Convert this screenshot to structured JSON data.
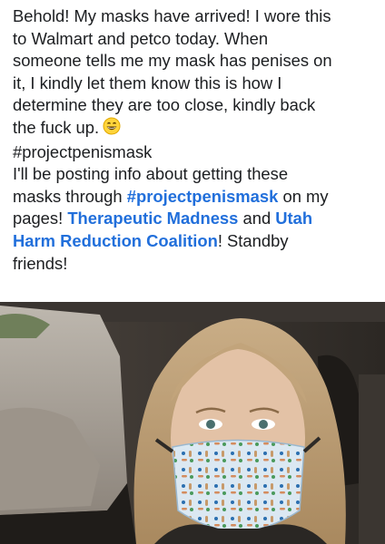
{
  "post": {
    "lines": [
      {
        "text": "Behold! My masks have arrived! I wore this"
      },
      {
        "text": "to Walmart and petco today. When"
      },
      {
        "text": "someone tells me my mask has penises on"
      },
      {
        "text": "it, I kindly let them know this is how I"
      },
      {
        "text": "determine they are too close, kindly back"
      },
      {
        "text": "the fuck up."
      },
      {
        "hashtag": "#projectpenismask"
      },
      {
        "text": "I'll be posting info about getting these"
      },
      {
        "pre": "masks through ",
        "tag": "#projectpenismask",
        "post": " on my"
      },
      {
        "pre": "pages! ",
        "tag": "Therapeutic Madness",
        "post": " and ",
        "tag2": "Utah"
      },
      {
        "tag": "Harm Reduction Coalition",
        "post": "! Standby"
      },
      {
        "text": "friends!"
      }
    ],
    "emoji": "grinning-face-emoji",
    "link_color": "#216fdb",
    "text_color": "#1c1e21"
  },
  "photo": {
    "subject": "woman-wearing-patterned-face-mask-in-car",
    "icon": "photo"
  }
}
